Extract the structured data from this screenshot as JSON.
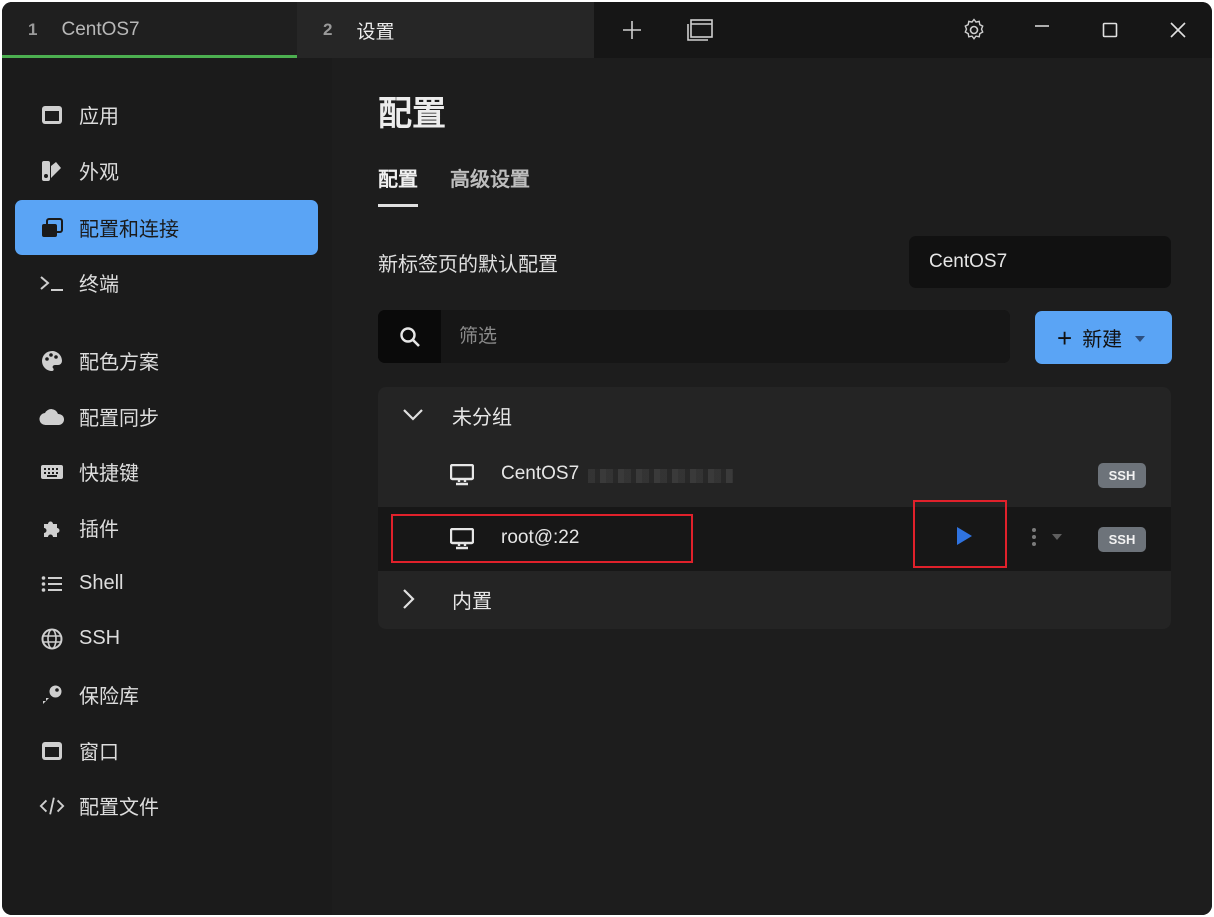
{
  "tabs": [
    {
      "num": "1",
      "label": "CentOS7"
    },
    {
      "num": "2",
      "label": "设置"
    }
  ],
  "sidebar": {
    "items": [
      {
        "label": "应用",
        "icon": "app-window-icon"
      },
      {
        "label": "外观",
        "icon": "swatchbook-icon"
      },
      {
        "label": "配置和连接",
        "icon": "window-restore-icon"
      },
      {
        "label": "终端",
        "icon": "terminal-prompt-icon"
      },
      {
        "label": "配色方案",
        "icon": "palette-icon"
      },
      {
        "label": "配置同步",
        "icon": "cloud-icon"
      },
      {
        "label": "快捷键",
        "icon": "keyboard-icon"
      },
      {
        "label": "插件",
        "icon": "puzzle-icon"
      },
      {
        "label": "Shell",
        "icon": "list-icon"
      },
      {
        "label": "SSH",
        "icon": "globe-icon"
      },
      {
        "label": "保险库",
        "icon": "key-icon"
      },
      {
        "label": "窗口",
        "icon": "window-icon"
      },
      {
        "label": "配置文件",
        "icon": "code-icon"
      }
    ],
    "active_index": 2
  },
  "main": {
    "title": "配置",
    "subtabs": [
      "配置",
      "高级设置"
    ],
    "default_profile_label": "新标签页的默认配置",
    "default_profile_value": "CentOS7",
    "filter_placeholder": "筛选",
    "new_button_label": "新建",
    "groups": [
      {
        "name": "未分组",
        "expanded": true,
        "profiles": [
          {
            "name": "CentOS7",
            "badge": "SSH"
          },
          {
            "name": "root@:22",
            "badge": "SSH"
          }
        ]
      },
      {
        "name": "内置",
        "expanded": false
      }
    ]
  },
  "colors": {
    "accent": "#5aa4f5",
    "active_tab_underline": "#4caf50",
    "play": "#2f73e0",
    "highlight_box": "#e0212b"
  }
}
